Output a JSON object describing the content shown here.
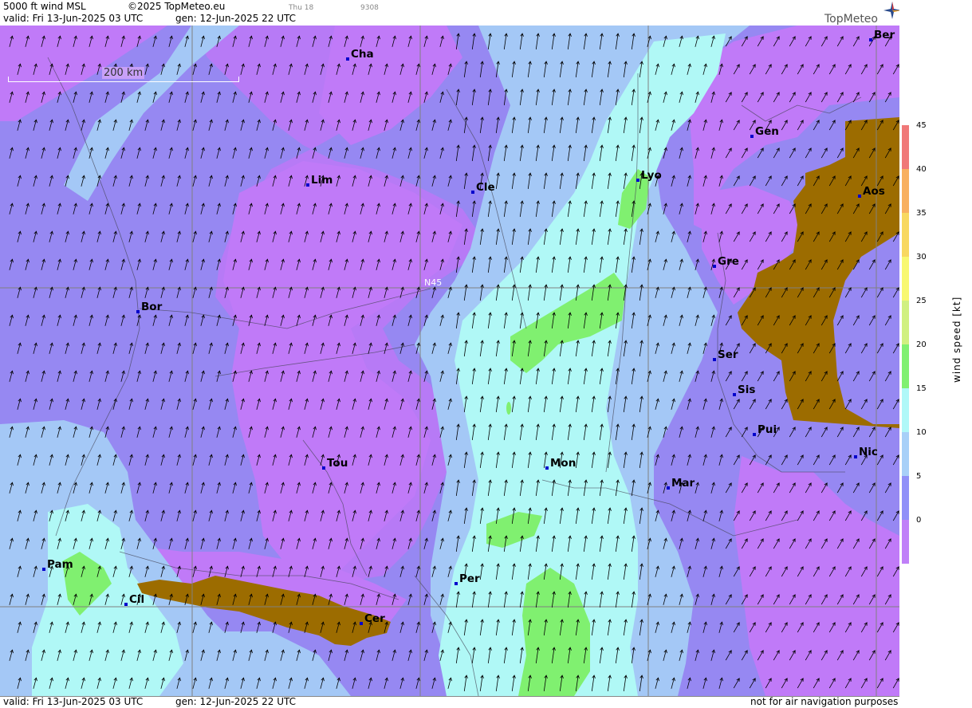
{
  "header": {
    "product": "5000 ft wind MSL",
    "copyright": "©2025 TopMeteo.eu",
    "day_small": "Thu 18",
    "code_small": "9308",
    "valid": "valid:  Fri  13-Jun-2025  03 UTC",
    "gen": "gen: 12-Jun-2025 22 UTC",
    "logo": "TopMeteo"
  },
  "footer": {
    "valid": "valid:  Fri  13-Jun-2025  03 UTC",
    "gen": "gen: 12-Jun-2025 22 UTC",
    "disclaimer": "not for air navigation purposes"
  },
  "map": {
    "scale_label": "200 km",
    "latitude_label": "N45",
    "cities": [
      {
        "name": "Cha"
      },
      {
        "name": "Ber"
      },
      {
        "name": "Gen"
      },
      {
        "name": "Lim"
      },
      {
        "name": "Cle"
      },
      {
        "name": "Lyo"
      },
      {
        "name": "Aos"
      },
      {
        "name": "Gre"
      },
      {
        "name": "Bor"
      },
      {
        "name": "Ser"
      },
      {
        "name": "Sis"
      },
      {
        "name": "Pui"
      },
      {
        "name": "Tou"
      },
      {
        "name": "Mon"
      },
      {
        "name": "Nic"
      },
      {
        "name": "Mar"
      },
      {
        "name": "Pam"
      },
      {
        "name": "Cil"
      },
      {
        "name": "Per"
      },
      {
        "name": "Cer"
      }
    ]
  },
  "legend": {
    "title": "wind  speed  [kt]",
    "ticks": [
      "45",
      "40",
      "35",
      "30",
      "25",
      "20",
      "15",
      "10",
      "5",
      "0"
    ],
    "colors": [
      "#f07878",
      "#f8b060",
      "#f8d860",
      "#f8f870",
      "#d0f080",
      "#80f070",
      "#b0f8f8",
      "#a8d0f8",
      "#9090f8",
      "#c080f8"
    ]
  },
  "colors": {
    "violet": "#c07af8",
    "purple_blue": "#9688f2",
    "light_blue": "#a4c8f6",
    "cyan": "#b0f8f6",
    "green": "#80f070",
    "terrain": "#9c6c00"
  }
}
